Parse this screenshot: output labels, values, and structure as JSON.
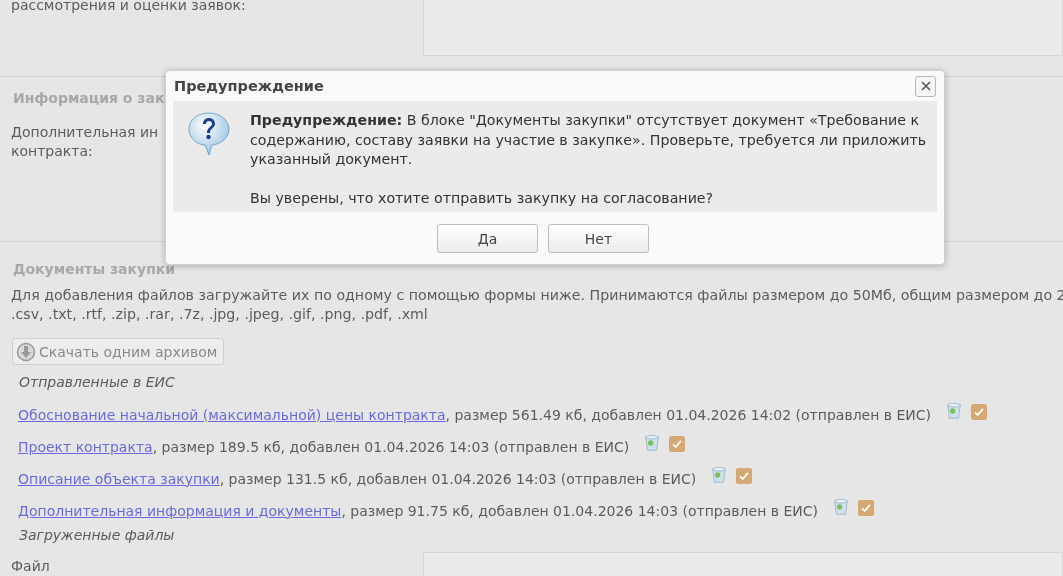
{
  "page": {
    "top_label": "рассмотрения и оценки заявок:",
    "info_section": {
      "legend": "Информация о зак",
      "label_lines": [
        "Дополнительная ин",
        "контракта:"
      ]
    },
    "docs_section": {
      "legend": "Документы закупки",
      "hint_lines": [
        "Для добавления файлов загружайте их по одному с помощью формы ниже. Принимаются файлы размером до 50Мб, общим размером до 2",
        ".csv, .txt, .rtf, .zip, .rar, .7z, .jpg, .jpeg, .gif, .png, .pdf, .xml"
      ],
      "download_button": "Скачать одним архивом",
      "sent_heading": "Отправленные в ЕИС",
      "files": [
        {
          "link": "Обоснование начальной (максимальной) цены контракта",
          "details": ", размер 561.49 кб, добавлен 01.04.2026 14:02 (отправлен в ЕИС)",
          "checked": true
        },
        {
          "link": "Проект контракта",
          "details": ", размер 189.5 кб, добавлен 01.04.2026 14:03 (отправлен в ЕИС)",
          "checked": true
        },
        {
          "link": "Описание объекта закупки",
          "details": ", размер 131.5 кб, добавлен 01.04.2026 14:03 (отправлен в ЕИС)",
          "checked": true
        },
        {
          "link": "Дополнительная информация и документы",
          "details": ", размер 91.75 кб, добавлен 01.04.2026 14:03 (отправлен в ЕИС)",
          "checked": true
        }
      ],
      "uploaded_heading": "Загруженные файлы",
      "file_label": "Файл"
    }
  },
  "dialog": {
    "title": "Предупреждение",
    "message": "**Предупреждение:** В блоке \"Документы закупки\" отсутствует документ «Требование к содержанию, составу заявки на участие в закупке». Проверьте, требуется ли приложить указанный документ.",
    "question": "Вы уверены, что хотите отправить закупку на согласование?",
    "buttons": [
      "Да",
      "Нет"
    ]
  }
}
